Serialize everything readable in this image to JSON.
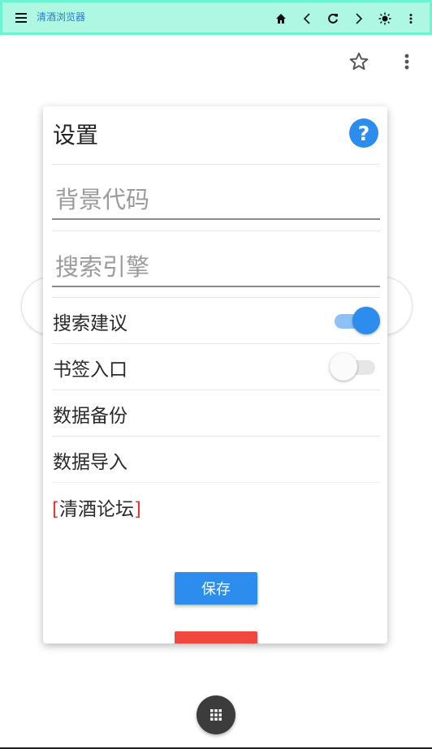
{
  "browser": {
    "title": "清酒浏览器"
  },
  "dialog": {
    "title": "设置",
    "help_icon": "?",
    "background_code_placeholder": "背景代码",
    "search_engine_placeholder": "搜索引擎",
    "search_suggestion_label": "搜索建议",
    "search_suggestion_enabled": true,
    "bookmark_entry_label": "书签入口",
    "bookmark_entry_enabled": false,
    "data_backup_label": "数据备份",
    "data_import_label": "数据导入",
    "forum_open": "[",
    "forum_label": "清酒论坛",
    "forum_close": "]",
    "save_label": "保存"
  },
  "colors": {
    "accent": "#2d8def",
    "danger": "#f0473f",
    "toolbar_bg": "#aef7e3"
  },
  "icons": [
    "menu-icon",
    "home-icon",
    "back-icon",
    "forward-icon",
    "refresh-icon",
    "brightness-icon",
    "more-vert-icon",
    "star-icon",
    "help-icon",
    "grid-icon"
  ]
}
